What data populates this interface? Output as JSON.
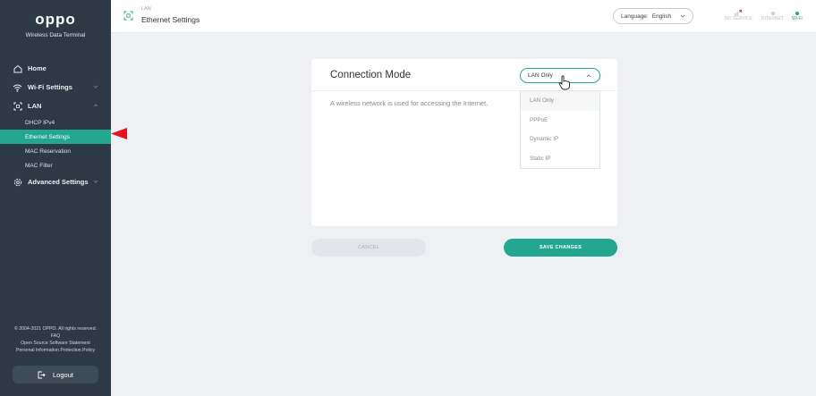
{
  "brand": {
    "logo": "oppo",
    "subtitle": "Wireless Data Terminal"
  },
  "sidebar": {
    "items": [
      {
        "label": "Home",
        "icon": "home-icon"
      },
      {
        "label": "Wi-Fi Settings",
        "icon": "wifi-icon"
      },
      {
        "label": "LAN",
        "icon": "lan-icon"
      },
      {
        "label": "Advanced Settings",
        "icon": "gear-icon"
      }
    ],
    "lan_subitems": [
      "DHCP IPv4",
      "Ethernet Settings",
      "MAC Reservation",
      "MAC Filter"
    ],
    "active_subitem": "Ethernet Settings",
    "footer": {
      "copyright": "© 2004-2021 OPPO. All rights reserved.",
      "faq": "FAQ",
      "open_source": "Open Source Software Statement",
      "privacy": "Personal Information Protection Policy"
    },
    "logout_label": "Logout"
  },
  "header": {
    "breadcrumb_parent": "LAN",
    "title": "Ethernet Settings",
    "language_label": "Language:",
    "language_value": "English",
    "status": {
      "no_service": "NO SERVICE",
      "internet": "INTERNET",
      "wifi": "Wi-Fi"
    }
  },
  "card": {
    "title": "Connection Mode",
    "description": "A wireless network is used for accessing the Internet.",
    "select_value": "LAN Only",
    "options": [
      "LAN Only",
      "PPPoE",
      "Dynamic IP",
      "Static IP"
    ]
  },
  "buttons": {
    "cancel": "CANCEL",
    "save": "SAVE CHANGES"
  },
  "colors": {
    "accent": "#23a88f",
    "sidebar_bg": "#2d3a45",
    "pointer": "#e5141d"
  }
}
